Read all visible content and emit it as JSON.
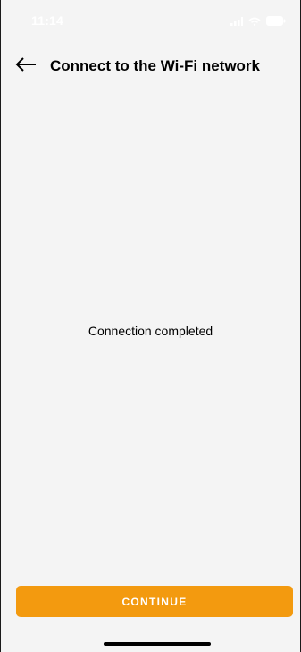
{
  "status_bar": {
    "time": "11:14",
    "icons": [
      "signal-icon",
      "wifi-icon",
      "battery-icon"
    ]
  },
  "header": {
    "back_icon": "back-arrow-icon",
    "title": "Connect to the Wi-Fi network"
  },
  "main": {
    "message": "Connection completed"
  },
  "footer": {
    "continue_label": "CONTINUE"
  },
  "colors": {
    "background": "#f4f4f4",
    "accent": "#f39a0f",
    "button_text": "#ffffff",
    "text": "#000000"
  }
}
